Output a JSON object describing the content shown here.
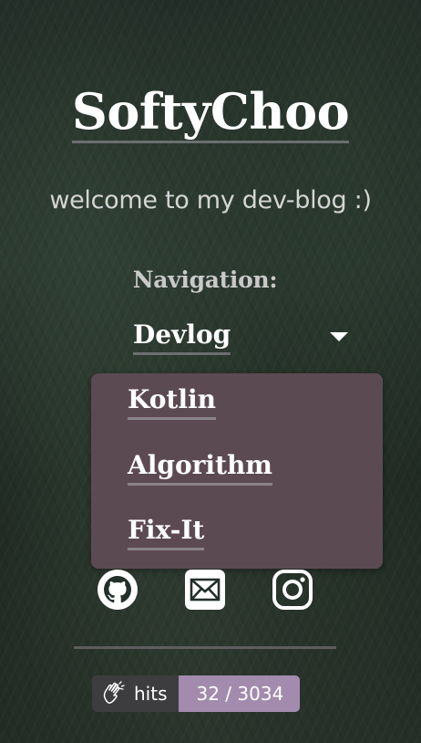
{
  "header": {
    "site_title": "SoftyChoo",
    "tagline": "welcome to my dev-blog :)"
  },
  "navigation": {
    "label": "Navigation:",
    "selected": "Devlog",
    "options": [
      {
        "label": "Kotlin"
      },
      {
        "label": "Algorithm"
      },
      {
        "label": "Fix-It"
      }
    ]
  },
  "social": [
    {
      "icon": "github-icon"
    },
    {
      "icon": "mail-icon"
    },
    {
      "icon": "instagram-icon"
    }
  ],
  "hits": {
    "label": "hits",
    "value": "32 / 3034"
  },
  "colors": {
    "dropdown_bg": "#5c4a52",
    "hits_label_bg": "#3d3d3f",
    "hits_value_bg": "#a38bad",
    "link_underline": "#82828a"
  }
}
